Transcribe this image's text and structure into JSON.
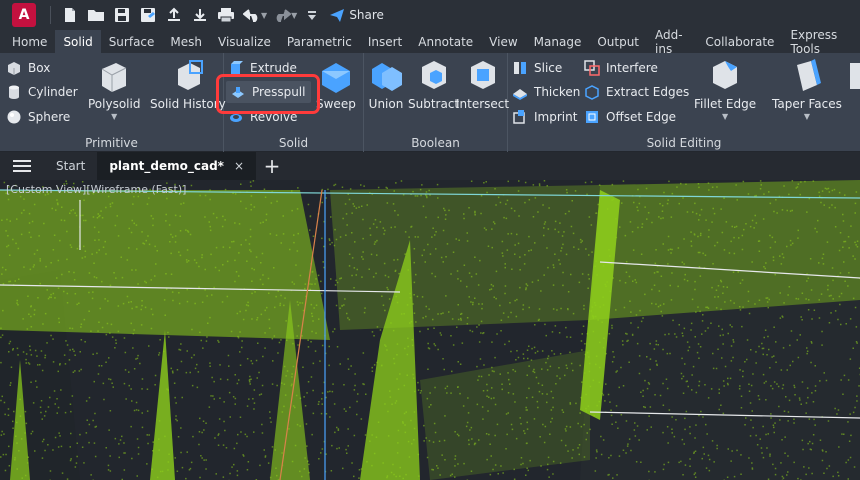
{
  "app": {
    "logo_letter": "A",
    "share_label": "Share"
  },
  "qat": {
    "icons": [
      "new-file-icon",
      "open-folder-icon",
      "save-icon",
      "save-as-icon",
      "cloud-upload-icon",
      "download-icon",
      "print-icon",
      "undo-icon",
      "redo-icon",
      "dropdown-icon",
      "share-icon"
    ]
  },
  "tabs": [
    "Home",
    "Solid",
    "Surface",
    "Mesh",
    "Visualize",
    "Parametric",
    "Insert",
    "Annotate",
    "View",
    "Manage",
    "Output",
    "Add-ins",
    "Collaborate",
    "Express Tools"
  ],
  "active_tab": "Solid",
  "ribbon": {
    "primitive": {
      "title": "Primitive",
      "box": "Box",
      "cylinder": "Cylinder",
      "sphere": "Sphere",
      "polysolid": "Polysolid",
      "solid_history": "Solid History"
    },
    "solid": {
      "title": "Solid",
      "extrude": "Extrude",
      "presspull": "Presspull",
      "revolve": "Revolve",
      "sweep": "Sweep"
    },
    "boolean": {
      "title": "Boolean",
      "union": "Union",
      "subtract": "Subtract",
      "intersect": "Intersect"
    },
    "solid_editing": {
      "title": "Solid Editing",
      "slice": "Slice",
      "thicken": "Thicken",
      "imprint": "Imprint",
      "interfere": "Interfere",
      "extract_edges": "Extract Edges",
      "offset_edge": "Offset Edge",
      "fillet_edge": "Fillet Edge",
      "taper_faces": "Taper Faces"
    }
  },
  "doc_tabs": {
    "start": "Start",
    "active": "plant_demo_cad*",
    "close": "×",
    "new": "+"
  },
  "viewport": {
    "label": "[Custom View][Wireframe (Fast)]"
  },
  "colors": {
    "accent_red": "#ff3b3b",
    "point_cloud": "#8fd11b",
    "ribbon_bg": "#3b4350",
    "logo": "#c4113f"
  }
}
